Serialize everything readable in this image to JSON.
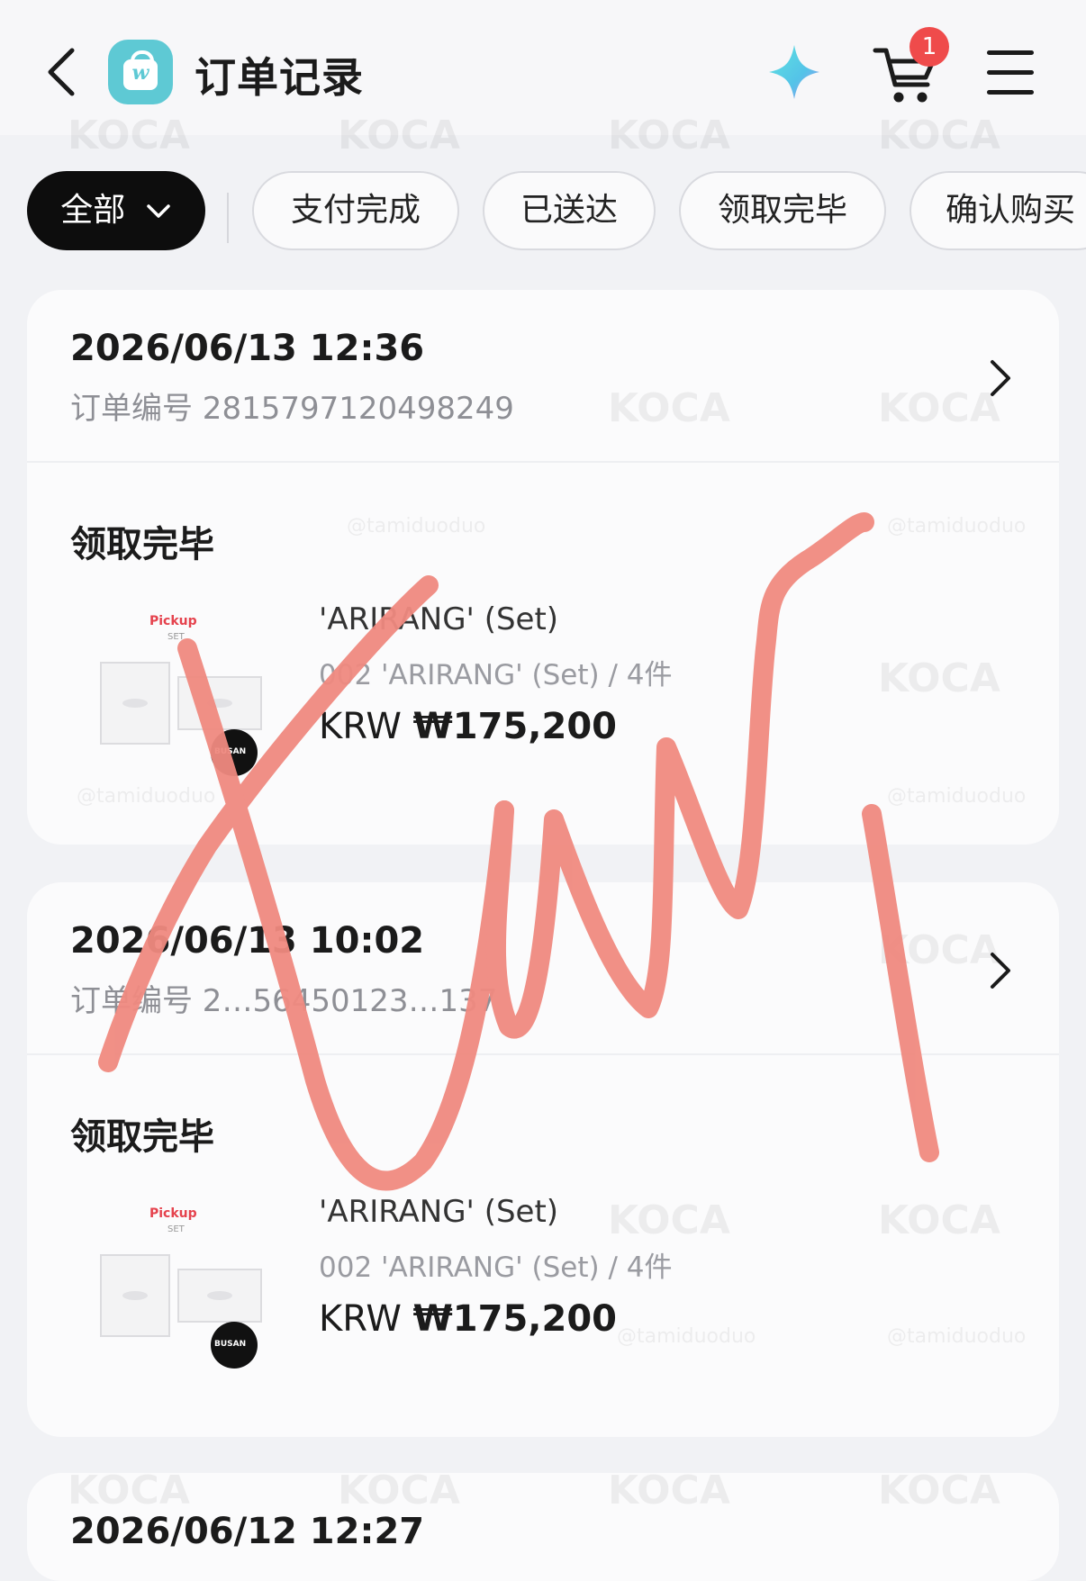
{
  "header": {
    "title": "订单记录",
    "cart_count": "1",
    "icons": [
      "back-icon",
      "app-logo-icon",
      "sparkle-icon",
      "cart-icon",
      "menu-icon"
    ]
  },
  "filters": [
    {
      "label": "全部",
      "active": true
    },
    {
      "label": "支付完成",
      "active": false
    },
    {
      "label": "已送达",
      "active": false
    },
    {
      "label": "领取完毕",
      "active": false
    },
    {
      "label": "确认购买",
      "active": false
    }
  ],
  "orders": [
    {
      "datetime": "2026/06/13 12:36",
      "order_no": "订单编号 2815797120498249",
      "status": "领取完毕",
      "thumb_label": "Pickup",
      "thumb_sub": "SET",
      "thumb_badge": "BUSAN",
      "item_name": "'ARIRANG' (Set)",
      "item_option": "002 'ARIRANG' (Set) / 4件",
      "currency": "KRW",
      "amount": "₩175,200"
    },
    {
      "datetime": "2026/06/13 10:02",
      "order_no": "订单编号 2…56450123…137",
      "status": "领取完毕",
      "thumb_label": "Pickup",
      "thumb_sub": "SET",
      "thumb_badge": "BUSAN",
      "item_name": "'ARIRANG' (Set)",
      "item_option": "002 'ARIRANG' (Set) / 4件",
      "currency": "KRW",
      "amount": "₩175,200"
    },
    {
      "datetime": "2026/06/12 12:27"
    }
  ],
  "watermark": {
    "logo": "KOCA",
    "handle": "@tamiduoduo"
  },
  "colors": {
    "accent_teal": "#5ec9d4",
    "badge_red": "#ef4b4b",
    "scribble": "#f08a80",
    "background": "#f1f2f5"
  }
}
